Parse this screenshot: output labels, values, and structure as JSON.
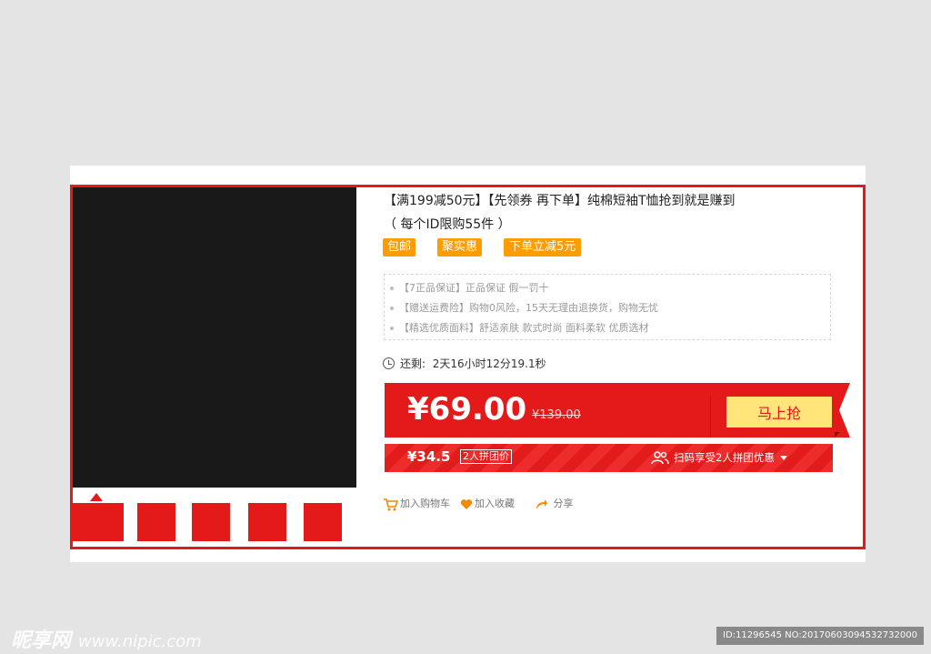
{
  "product": {
    "title_line1": "【满199减50元】【先领券 再下单】纯棉短袖T恤抢到就是赚到",
    "title_line2": "（ 每个ID限购55件 ）",
    "tags": [
      "包邮",
      "聚实惠",
      "下单立减5元"
    ],
    "features": [
      "【7正品保证】正品保证 假一罚十",
      "【赠送运费险】购物0风险，15天无理由退换货，购物无忧",
      "【精选优质面料】舒适亲肤 款式时尚 面料柔软 优质选材"
    ]
  },
  "countdown": {
    "label": "还剩:",
    "value": "2天16小时12分19.1秒",
    "icon": "clock-icon"
  },
  "price": {
    "current": "¥69.00",
    "original": "¥139.00",
    "buy_button": "马上抢"
  },
  "group": {
    "price": "¥34.5",
    "badge": "2人拼团价",
    "scan_text": "扫码享受2人拼团优惠",
    "icon": "people-icon"
  },
  "actions": {
    "cart": "加入购物车",
    "favorite": "加入收藏",
    "share": "分享"
  },
  "watermark": {
    "brand": "昵享网",
    "url": "www.nipic.com",
    "id": "ID:11296545 NO:20170603094532732000"
  },
  "colors": {
    "accent_red": "#e41919",
    "tag_orange": "#ff9d00",
    "button_yellow": "#ffe57a"
  }
}
